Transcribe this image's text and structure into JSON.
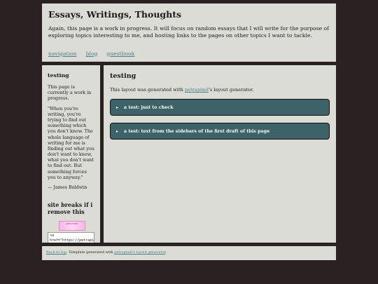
{
  "header": {
    "title": "Essays, Writings, Thoughts",
    "intro": "Again, this page is a work in progress. It will focus on random essays that I will write for the purpose of exploring topics interesting to me, and hosting links to the pages on other topics I want to tackle.",
    "nav": [
      "navigation",
      "blog",
      "guestbook"
    ]
  },
  "sidebar": {
    "heading": "testing",
    "status": "This page is currently a work in progress.",
    "quote": "\"When you're writing, you're trying to find out something which you don't know. The whole language of writing for me is finding out what you don't want to know, what you don't want to find out. But something forces you to anyway.\"",
    "attribution": "— James Baldwin",
    "warning_heading": "site breaks if i remove this",
    "badge_text": "petraixel",
    "code_snippet": "<a\nhref=\"https://petrapix"
  },
  "main": {
    "heading": "testing",
    "generated_prefix": "This layout was generated with ",
    "generated_link": "petrapixel",
    "generated_suffix": "'s layout generator.",
    "details": [
      {
        "arrow": "▸",
        "label": "a test: just to check"
      },
      {
        "arrow": "▸",
        "label": "a test: text from the sidebars of the first draft of this page"
      }
    ]
  },
  "footer": {
    "back_link": "Back to top",
    "text": ". Template generated with ",
    "generator_link": "petrapixel's layout generator",
    "end": "."
  }
}
